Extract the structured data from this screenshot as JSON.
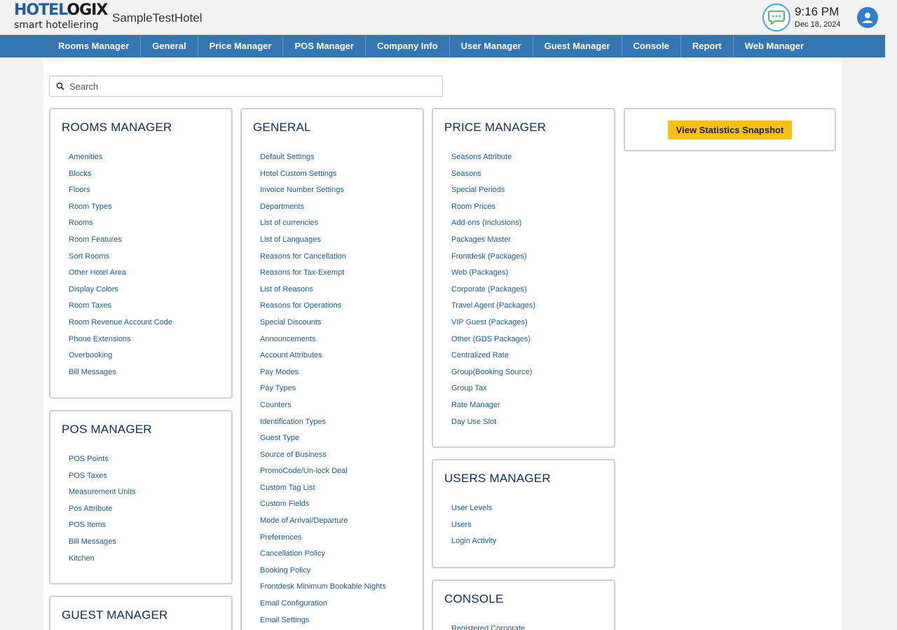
{
  "header": {
    "logo_main_1": "HOTEL",
    "logo_main_2": "OGIX",
    "logo_sub": "smart hoteliering",
    "hotel_name": "SampleTestHotel",
    "time": "9:16 PM",
    "date": "Dec 18, 2024"
  },
  "nav": [
    "Rooms Manager",
    "General",
    "Price Manager",
    "POS Manager",
    "Company Info",
    "User Manager",
    "Guest Manager",
    "Console",
    "Report",
    "Web Manager"
  ],
  "search": {
    "placeholder": "Search"
  },
  "stats_button": "View Statistics Snapshot",
  "cards": {
    "rooms": {
      "title": "ROOMS MANAGER",
      "items": [
        "Amenities",
        "Blocks",
        "Floors",
        "Room Types",
        "Rooms",
        "Room Features",
        "Sort Rooms",
        "Other Hotel Area",
        "Display Colors",
        "Room Taxes",
        "Room Revenue Account Code",
        "Phone Extensions",
        "Overbooking",
        "Bill Messages"
      ]
    },
    "pos": {
      "title": "POS MANAGER",
      "items": [
        "POS Points",
        "POS Taxes",
        "Measurement Units",
        "Pos Attribute",
        "POS Items",
        "Bill Messages",
        "Kitchen"
      ]
    },
    "guest": {
      "title": "GUEST MANAGER"
    },
    "general": {
      "title": "GENERAL",
      "items": [
        "Default Settings",
        "Hotel Custom Settings",
        "Invoice Number Settings",
        "Departments",
        "List of currencies",
        "List of Languages",
        "Reasons for Cancellation",
        "Reasons for Tax-Exempt",
        "List of Reasons",
        "Reasons for Operations",
        "Special Discounts",
        "Announcements",
        "Account Attributes",
        "Pay Modes",
        "Pay Types",
        "Counters",
        "Identification Types",
        "Guest Type",
        "Source of Business",
        "PromoCode/Un-lock Deal",
        "Custom Tag List",
        "Custom Fields",
        "Mode of Arrival/Departure",
        "Preferences",
        "Cancellation Policy",
        "Booking Policy",
        "Frontdesk Minimum Bookable Nights",
        "Email Configuration",
        "Email Settings"
      ]
    },
    "price": {
      "title": "PRICE MANAGER",
      "items": [
        "Seasons Attribute",
        "Seasons",
        "Special Periods",
        "Room Prices",
        "Add-ons (Inclusions)",
        "Packages Master",
        "Frontdesk (Packages)",
        "Web (Packages)",
        "Corporate (Packages)",
        "Travel Agent (Packages)",
        "VIP Guest (Packages)",
        "Other (GDS Packages)",
        "Centralized Rate",
        "Group(Booking Source)",
        "Group Tax",
        "Rate Manager",
        "Day Use Slot"
      ]
    },
    "users": {
      "title": "USERS MANAGER",
      "items": [
        "User Levels",
        "Users",
        "Login Activity"
      ]
    },
    "console": {
      "title": "CONSOLE",
      "items": [
        "Registered Corporate"
      ]
    }
  },
  "colors": {
    "nav_bg": "#3277b3",
    "link": "#1c5a9e",
    "title": "#0d2d5c",
    "accent_button": "#ffc107"
  }
}
